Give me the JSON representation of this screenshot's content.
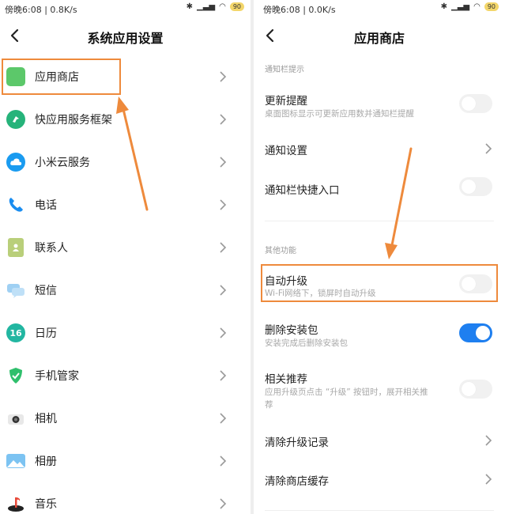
{
  "left": {
    "status": {
      "time": "傍晚6:08 | 0.8K/s",
      "battery": "90"
    },
    "title": "系统应用设置",
    "items": [
      {
        "label": "应用商店",
        "icon": "app-store-icon"
      },
      {
        "label": "快应用服务框架",
        "icon": "quick-app-icon"
      },
      {
        "label": "小米云服务",
        "icon": "cloud-icon"
      },
      {
        "label": "电话",
        "icon": "phone-icon"
      },
      {
        "label": "联系人",
        "icon": "contacts-icon"
      },
      {
        "label": "短信",
        "icon": "sms-icon"
      },
      {
        "label": "日历",
        "icon": "calendar-icon",
        "icon_text": "16"
      },
      {
        "label": "手机管家",
        "icon": "security-icon"
      },
      {
        "label": "相机",
        "icon": "camera-icon"
      },
      {
        "label": "相册",
        "icon": "gallery-icon"
      },
      {
        "label": "音乐",
        "icon": "music-icon"
      }
    ]
  },
  "right": {
    "status": {
      "time": "傍晚6:08 | 0.0K/s",
      "battery": "90"
    },
    "title": "应用商店",
    "section1": "通知栏提示",
    "rows1": [
      {
        "title": "更新提醒",
        "sub": "桌面图标显示可更新应用数并通知栏提醒",
        "control": "toggle",
        "on": false
      },
      {
        "title": "通知设置",
        "control": "chevron"
      },
      {
        "title": "通知栏快捷入口",
        "control": "toggle",
        "on": false
      }
    ],
    "section2": "其他功能",
    "rows2": [
      {
        "title": "自动升级",
        "sub": "Wi-Fi网络下，锁屏时自动升级",
        "control": "toggle",
        "on": false
      },
      {
        "title": "删除安装包",
        "sub": "安装完成后删除安装包",
        "control": "toggle",
        "on": true
      },
      {
        "title": "相关推荐",
        "sub1": "应用升级页点击 “升级” 按钮时，展开相关推",
        "sub2": "荐",
        "control": "toggle",
        "on": false
      },
      {
        "title": "清除升级记录",
        "control": "chevron"
      },
      {
        "title": "清除商店缓存",
        "control": "chevron"
      }
    ]
  },
  "colors": {
    "accent": "#1e7ff0",
    "highlight": "#ee8a3c",
    "toggle_off": "#f1f1f1"
  }
}
